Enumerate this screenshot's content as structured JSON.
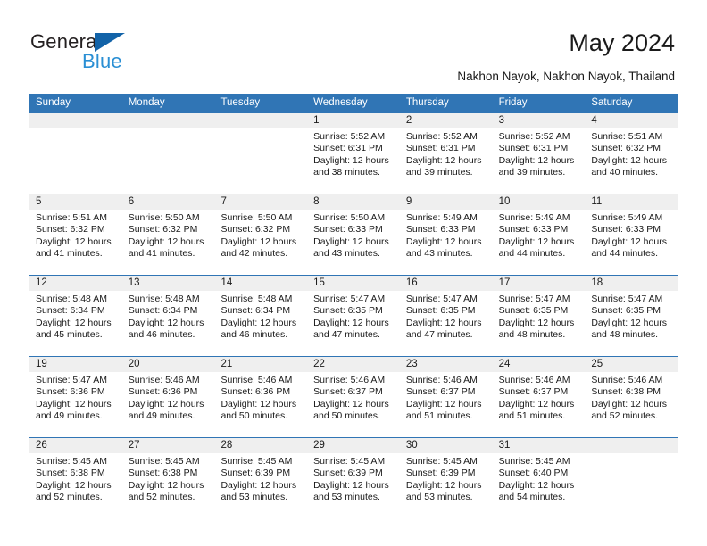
{
  "brand": {
    "name_part1": "General",
    "name_part2": "Blue",
    "accent_color": "#2a8fd4",
    "triangle_color": "#1263a8"
  },
  "header": {
    "title": "May 2024",
    "location": "Nakhon Nayok, Nakhon Nayok, Thailand"
  },
  "theme": {
    "header_blue": "#3075b5",
    "strip_gray": "#efefef",
    "text": "#1a1a1a"
  },
  "weekday_headers": [
    "Sunday",
    "Monday",
    "Tuesday",
    "Wednesday",
    "Thursday",
    "Friday",
    "Saturday"
  ],
  "weeks": [
    {
      "days": [
        {
          "num": "",
          "sunrise": "",
          "sunset": "",
          "daylight1": "",
          "daylight2": ""
        },
        {
          "num": "",
          "sunrise": "",
          "sunset": "",
          "daylight1": "",
          "daylight2": ""
        },
        {
          "num": "",
          "sunrise": "",
          "sunset": "",
          "daylight1": "",
          "daylight2": ""
        },
        {
          "num": "1",
          "sunrise": "Sunrise: 5:52 AM",
          "sunset": "Sunset: 6:31 PM",
          "daylight1": "Daylight: 12 hours",
          "daylight2": "and 38 minutes."
        },
        {
          "num": "2",
          "sunrise": "Sunrise: 5:52 AM",
          "sunset": "Sunset: 6:31 PM",
          "daylight1": "Daylight: 12 hours",
          "daylight2": "and 39 minutes."
        },
        {
          "num": "3",
          "sunrise": "Sunrise: 5:52 AM",
          "sunset": "Sunset: 6:31 PM",
          "daylight1": "Daylight: 12 hours",
          "daylight2": "and 39 minutes."
        },
        {
          "num": "4",
          "sunrise": "Sunrise: 5:51 AM",
          "sunset": "Sunset: 6:32 PM",
          "daylight1": "Daylight: 12 hours",
          "daylight2": "and 40 minutes."
        }
      ]
    },
    {
      "days": [
        {
          "num": "5",
          "sunrise": "Sunrise: 5:51 AM",
          "sunset": "Sunset: 6:32 PM",
          "daylight1": "Daylight: 12 hours",
          "daylight2": "and 41 minutes."
        },
        {
          "num": "6",
          "sunrise": "Sunrise: 5:50 AM",
          "sunset": "Sunset: 6:32 PM",
          "daylight1": "Daylight: 12 hours",
          "daylight2": "and 41 minutes."
        },
        {
          "num": "7",
          "sunrise": "Sunrise: 5:50 AM",
          "sunset": "Sunset: 6:32 PM",
          "daylight1": "Daylight: 12 hours",
          "daylight2": "and 42 minutes."
        },
        {
          "num": "8",
          "sunrise": "Sunrise: 5:50 AM",
          "sunset": "Sunset: 6:33 PM",
          "daylight1": "Daylight: 12 hours",
          "daylight2": "and 43 minutes."
        },
        {
          "num": "9",
          "sunrise": "Sunrise: 5:49 AM",
          "sunset": "Sunset: 6:33 PM",
          "daylight1": "Daylight: 12 hours",
          "daylight2": "and 43 minutes."
        },
        {
          "num": "10",
          "sunrise": "Sunrise: 5:49 AM",
          "sunset": "Sunset: 6:33 PM",
          "daylight1": "Daylight: 12 hours",
          "daylight2": "and 44 minutes."
        },
        {
          "num": "11",
          "sunrise": "Sunrise: 5:49 AM",
          "sunset": "Sunset: 6:33 PM",
          "daylight1": "Daylight: 12 hours",
          "daylight2": "and 44 minutes."
        }
      ]
    },
    {
      "days": [
        {
          "num": "12",
          "sunrise": "Sunrise: 5:48 AM",
          "sunset": "Sunset: 6:34 PM",
          "daylight1": "Daylight: 12 hours",
          "daylight2": "and 45 minutes."
        },
        {
          "num": "13",
          "sunrise": "Sunrise: 5:48 AM",
          "sunset": "Sunset: 6:34 PM",
          "daylight1": "Daylight: 12 hours",
          "daylight2": "and 46 minutes."
        },
        {
          "num": "14",
          "sunrise": "Sunrise: 5:48 AM",
          "sunset": "Sunset: 6:34 PM",
          "daylight1": "Daylight: 12 hours",
          "daylight2": "and 46 minutes."
        },
        {
          "num": "15",
          "sunrise": "Sunrise: 5:47 AM",
          "sunset": "Sunset: 6:35 PM",
          "daylight1": "Daylight: 12 hours",
          "daylight2": "and 47 minutes."
        },
        {
          "num": "16",
          "sunrise": "Sunrise: 5:47 AM",
          "sunset": "Sunset: 6:35 PM",
          "daylight1": "Daylight: 12 hours",
          "daylight2": "and 47 minutes."
        },
        {
          "num": "17",
          "sunrise": "Sunrise: 5:47 AM",
          "sunset": "Sunset: 6:35 PM",
          "daylight1": "Daylight: 12 hours",
          "daylight2": "and 48 minutes."
        },
        {
          "num": "18",
          "sunrise": "Sunrise: 5:47 AM",
          "sunset": "Sunset: 6:35 PM",
          "daylight1": "Daylight: 12 hours",
          "daylight2": "and 48 minutes."
        }
      ]
    },
    {
      "days": [
        {
          "num": "19",
          "sunrise": "Sunrise: 5:47 AM",
          "sunset": "Sunset: 6:36 PM",
          "daylight1": "Daylight: 12 hours",
          "daylight2": "and 49 minutes."
        },
        {
          "num": "20",
          "sunrise": "Sunrise: 5:46 AM",
          "sunset": "Sunset: 6:36 PM",
          "daylight1": "Daylight: 12 hours",
          "daylight2": "and 49 minutes."
        },
        {
          "num": "21",
          "sunrise": "Sunrise: 5:46 AM",
          "sunset": "Sunset: 6:36 PM",
          "daylight1": "Daylight: 12 hours",
          "daylight2": "and 50 minutes."
        },
        {
          "num": "22",
          "sunrise": "Sunrise: 5:46 AM",
          "sunset": "Sunset: 6:37 PM",
          "daylight1": "Daylight: 12 hours",
          "daylight2": "and 50 minutes."
        },
        {
          "num": "23",
          "sunrise": "Sunrise: 5:46 AM",
          "sunset": "Sunset: 6:37 PM",
          "daylight1": "Daylight: 12 hours",
          "daylight2": "and 51 minutes."
        },
        {
          "num": "24",
          "sunrise": "Sunrise: 5:46 AM",
          "sunset": "Sunset: 6:37 PM",
          "daylight1": "Daylight: 12 hours",
          "daylight2": "and 51 minutes."
        },
        {
          "num": "25",
          "sunrise": "Sunrise: 5:46 AM",
          "sunset": "Sunset: 6:38 PM",
          "daylight1": "Daylight: 12 hours",
          "daylight2": "and 52 minutes."
        }
      ]
    },
    {
      "days": [
        {
          "num": "26",
          "sunrise": "Sunrise: 5:45 AM",
          "sunset": "Sunset: 6:38 PM",
          "daylight1": "Daylight: 12 hours",
          "daylight2": "and 52 minutes."
        },
        {
          "num": "27",
          "sunrise": "Sunrise: 5:45 AM",
          "sunset": "Sunset: 6:38 PM",
          "daylight1": "Daylight: 12 hours",
          "daylight2": "and 52 minutes."
        },
        {
          "num": "28",
          "sunrise": "Sunrise: 5:45 AM",
          "sunset": "Sunset: 6:39 PM",
          "daylight1": "Daylight: 12 hours",
          "daylight2": "and 53 minutes."
        },
        {
          "num": "29",
          "sunrise": "Sunrise: 5:45 AM",
          "sunset": "Sunset: 6:39 PM",
          "daylight1": "Daylight: 12 hours",
          "daylight2": "and 53 minutes."
        },
        {
          "num": "30",
          "sunrise": "Sunrise: 5:45 AM",
          "sunset": "Sunset: 6:39 PM",
          "daylight1": "Daylight: 12 hours",
          "daylight2": "and 53 minutes."
        },
        {
          "num": "31",
          "sunrise": "Sunrise: 5:45 AM",
          "sunset": "Sunset: 6:40 PM",
          "daylight1": "Daylight: 12 hours",
          "daylight2": "and 54 minutes."
        },
        {
          "num": "",
          "sunrise": "",
          "sunset": "",
          "daylight1": "",
          "daylight2": ""
        }
      ]
    }
  ]
}
